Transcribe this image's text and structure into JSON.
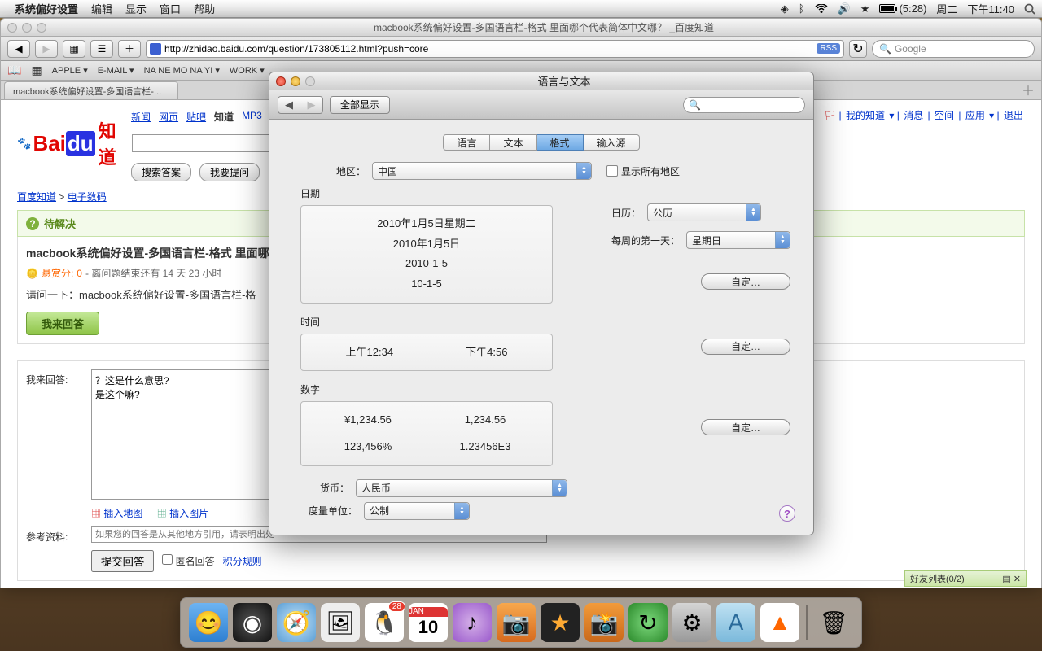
{
  "menubar": {
    "app": "系统偏好设置",
    "items": [
      "编辑",
      "显示",
      "窗口",
      "帮助"
    ],
    "battery": "(5:28)",
    "day": "周二",
    "time": "下午11:40"
  },
  "browser": {
    "title": "macbook系统偏好设置-多国语言栏-格式 里面哪个代表简体中文哪？ _百度知道",
    "url": "http://zhidao.baidu.com/question/173805112.html?push=core",
    "rss": "RSS",
    "search_placeholder": "Google",
    "bookmarks": [
      "APPLE",
      "E-MAIL",
      "NA NE MO NA YI",
      "WORK"
    ],
    "tab": "macbook系统偏好设置-多国语言栏-..."
  },
  "page": {
    "topnav": [
      "新闻",
      "网页",
      "贴吧",
      "知道",
      "MP3"
    ],
    "logo_zhidao": "知道",
    "btn_search": "搜索答案",
    "btn_ask": "我要提问",
    "crumb1": "百度知道",
    "crumb2": "电子数码",
    "pending": "待解决",
    "qtitle": "macbook系统偏好设置-多国语言栏-格式 里面哪个",
    "bounty_label": "悬赏分:",
    "bounty_val": "0",
    "deadline": "- 离问题结束还有 14 天 23 小时",
    "qdesc": "请问一下：macbook系统偏好设置-多国语言栏-格",
    "btn_answer": "我来回答",
    "answer_label": "我来回答:",
    "answer_text": "？这是什么意思?\n是这个嘛?",
    "insert_map": "插入地图",
    "insert_img": "插入图片",
    "ref_label": "参考资料:",
    "ref_placeholder": "如果您的回答是从其他地方引用，请表明出处",
    "submit": "提交回答",
    "anon": "匿名回答",
    "rules": "积分规则",
    "rlink_my": "我的知道",
    "rlink_msg": "消息",
    "rlink_space": "空间",
    "rlink_app": "应用",
    "rlink_logout": "退出",
    "friends": "好友列表(0/2)"
  },
  "prefs": {
    "title": "语言与文本",
    "showall": "全部显示",
    "tabs": [
      "语言",
      "文本",
      "格式",
      "输入源"
    ],
    "region_label": "地区：",
    "region_val": "中国",
    "showall_regions": "显示所有地区",
    "date_label": "日期",
    "date_samples": [
      "2010年1月5日星期二",
      "2010年1月5日",
      "2010-1-5",
      "10-1-5"
    ],
    "calendar_label": "日历：",
    "calendar_val": "公历",
    "weekstart_label": "每周的第一天：",
    "weekstart_val": "星期日",
    "customize": "自定…",
    "time_label": "时间",
    "time_am": "上午12:34",
    "time_pm": "下午4:56",
    "number_label": "数字",
    "num1": "¥1,234.56",
    "num2": "1,234.56",
    "num3": "123,456%",
    "num4": "1.23456E3",
    "currency_label": "货币：",
    "currency_val": "人民币",
    "measure_label": "度量单位：",
    "measure_val": "公制"
  },
  "dock": {
    "qq_badge": "28",
    "cal_day": "10"
  }
}
